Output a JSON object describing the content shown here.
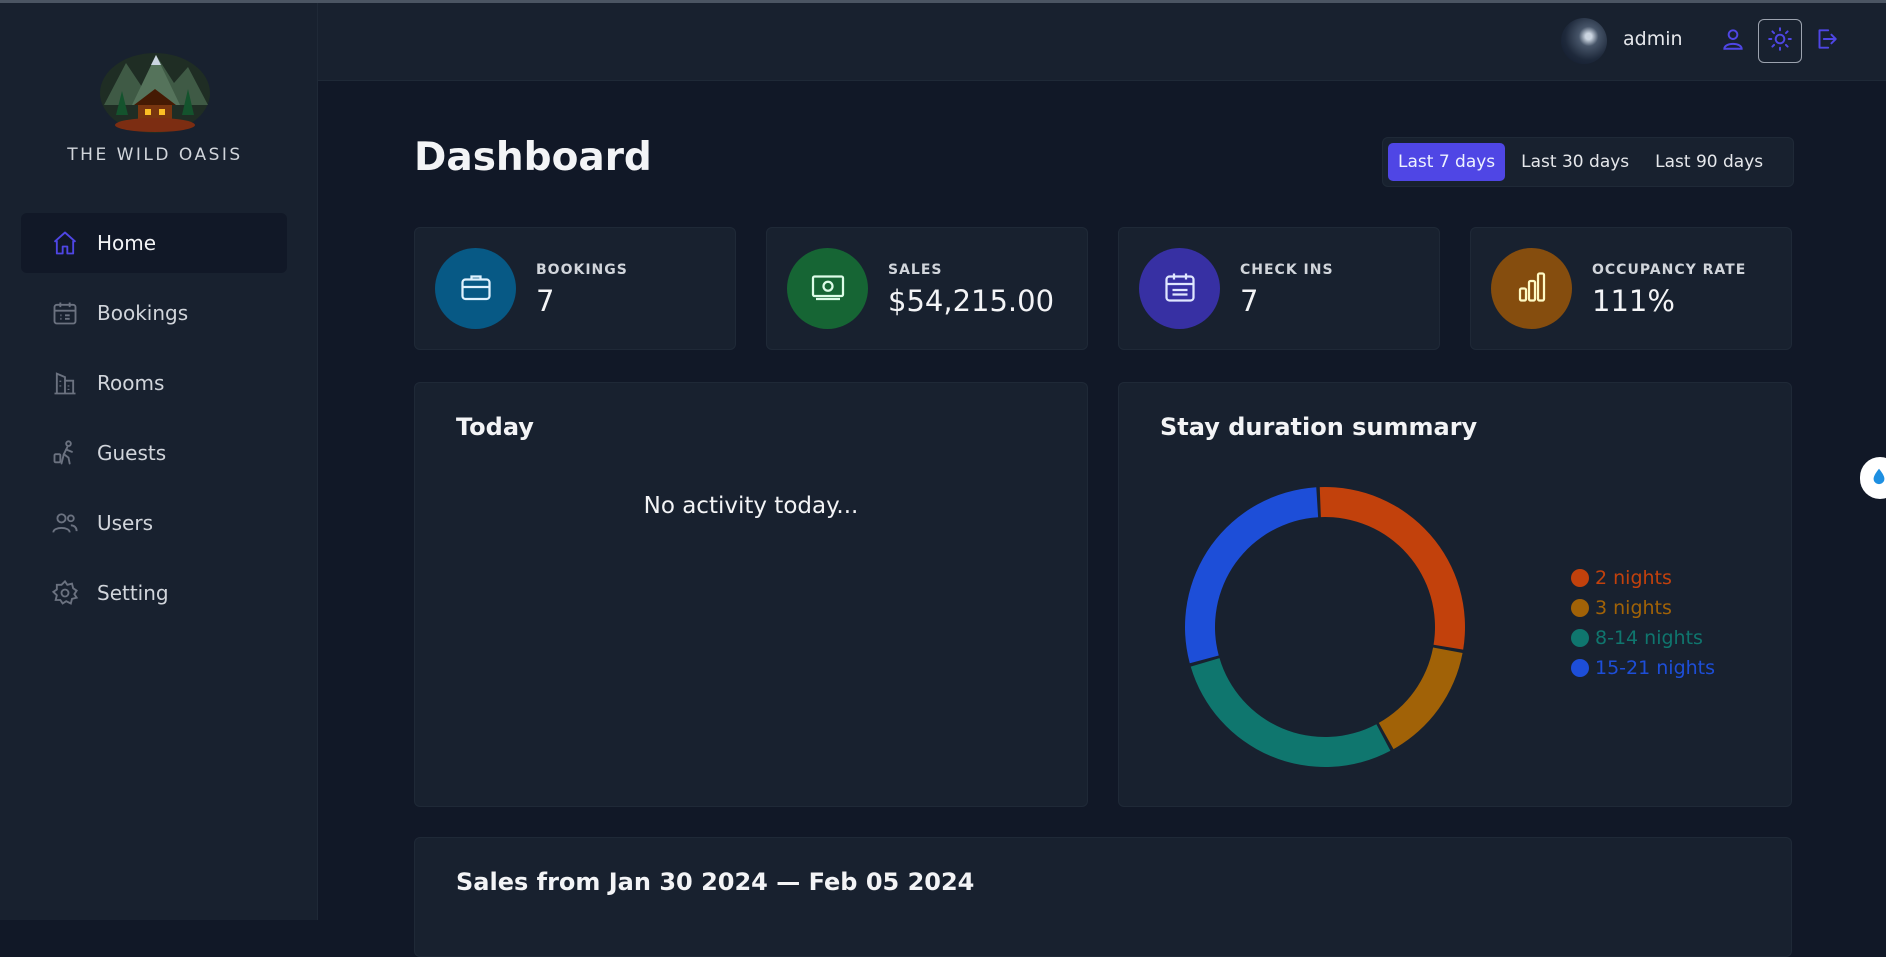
{
  "brand": {
    "name": "THE WILD OASIS"
  },
  "sidebar": {
    "items": [
      {
        "label": "Home",
        "icon": "home-icon",
        "active": true
      },
      {
        "label": "Bookings",
        "icon": "calendar-icon"
      },
      {
        "label": "Rooms",
        "icon": "building-icon"
      },
      {
        "label": "Guests",
        "icon": "guest-icon"
      },
      {
        "label": "Users",
        "icon": "users-icon"
      },
      {
        "label": "Setting",
        "icon": "gear-icon"
      }
    ]
  },
  "header": {
    "username": "admin",
    "icons": [
      "user-icon",
      "sun-icon",
      "logout-icon"
    ]
  },
  "main": {
    "title": "Dashboard",
    "filters": [
      {
        "label": "Last 7 days",
        "active": true
      },
      {
        "label": "Last 30 days"
      },
      {
        "label": "Last 90 days"
      }
    ],
    "stats": [
      {
        "label": "BOOKINGS",
        "value": "7",
        "icon": "briefcase-icon",
        "color": "#075985"
      },
      {
        "label": "SALES",
        "value": "$54,215.00",
        "icon": "banknote-icon",
        "color": "#166534"
      },
      {
        "label": "CHECK INS",
        "value": "7",
        "icon": "calendar-icon",
        "color": "#3730a3"
      },
      {
        "label": "OCCUPANCY RATE",
        "value": "111%",
        "icon": "chart-bar-icon",
        "color": "#854d0e"
      }
    ],
    "today": {
      "title": "Today",
      "empty_text": "No activity today..."
    },
    "stay_duration": {
      "title": "Stay duration summary"
    },
    "sales": {
      "title": "Sales from Jan 30 2024 — Feb 05 2024"
    }
  },
  "chart_data": {
    "type": "pie",
    "title": "Stay duration summary",
    "categories": [
      "2 nights",
      "3 nights",
      "8-14 nights",
      "15-21 nights"
    ],
    "values": [
      2,
      1,
      2,
      2
    ],
    "colors": [
      "#c2410c",
      "#a16207",
      "#0f766e",
      "#1d4ed8"
    ],
    "legend": "right"
  }
}
